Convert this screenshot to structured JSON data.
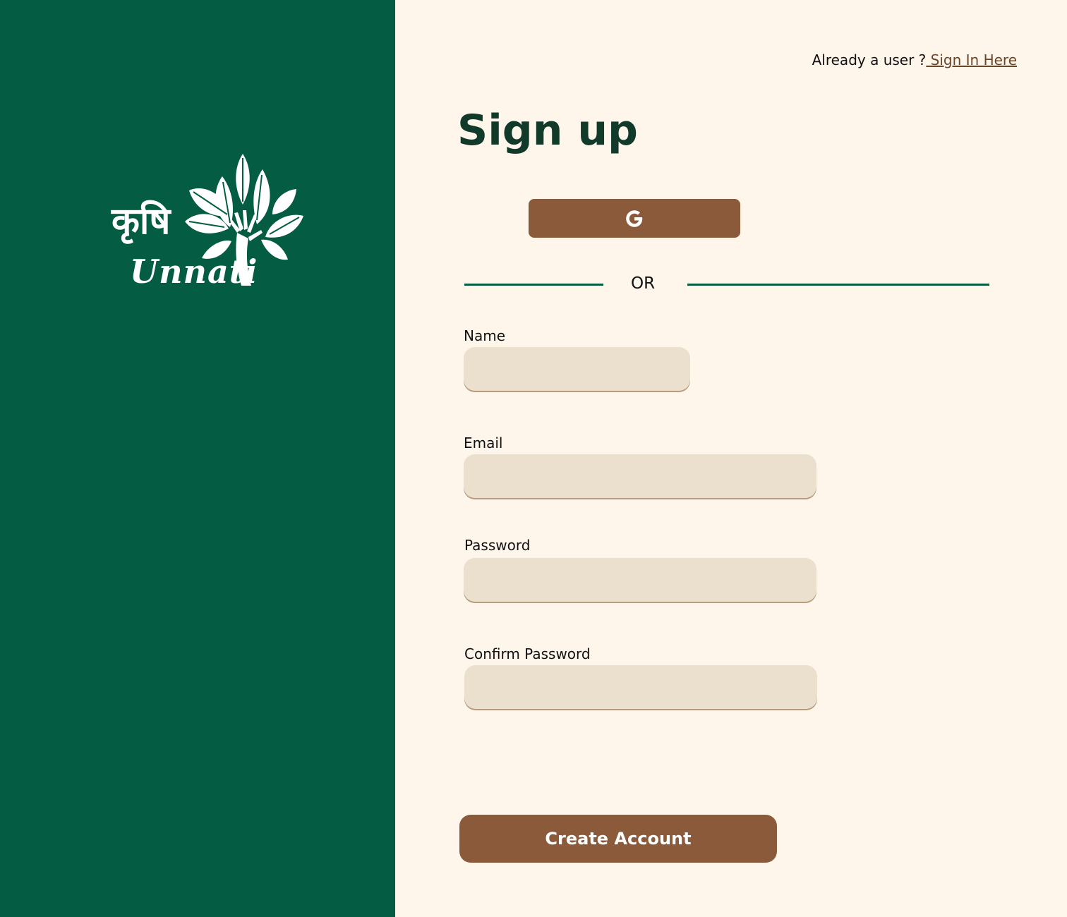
{
  "brand": {
    "hindi_text": "कृषि",
    "latin_text": "Unnati"
  },
  "header": {
    "prompt_text": "Already a user ?",
    "signin_link": " Sign In Here"
  },
  "title": "Sign up",
  "google_button": {
    "icon": "google-g-icon"
  },
  "divider_text": "OR",
  "form": {
    "name_label": "Name",
    "name_value": "",
    "email_label": "Email",
    "email_value": "",
    "password_label": "Password",
    "password_value": "",
    "confirm_label": "Confirm Password",
    "confirm_value": "",
    "submit_label": "Create Account"
  },
  "colors": {
    "sidebar": "#045D43",
    "background": "#FFF6EB",
    "button": "#8A5A3A",
    "input": "#EBDFCE",
    "title": "#123A2B",
    "link": "#6B4528"
  }
}
